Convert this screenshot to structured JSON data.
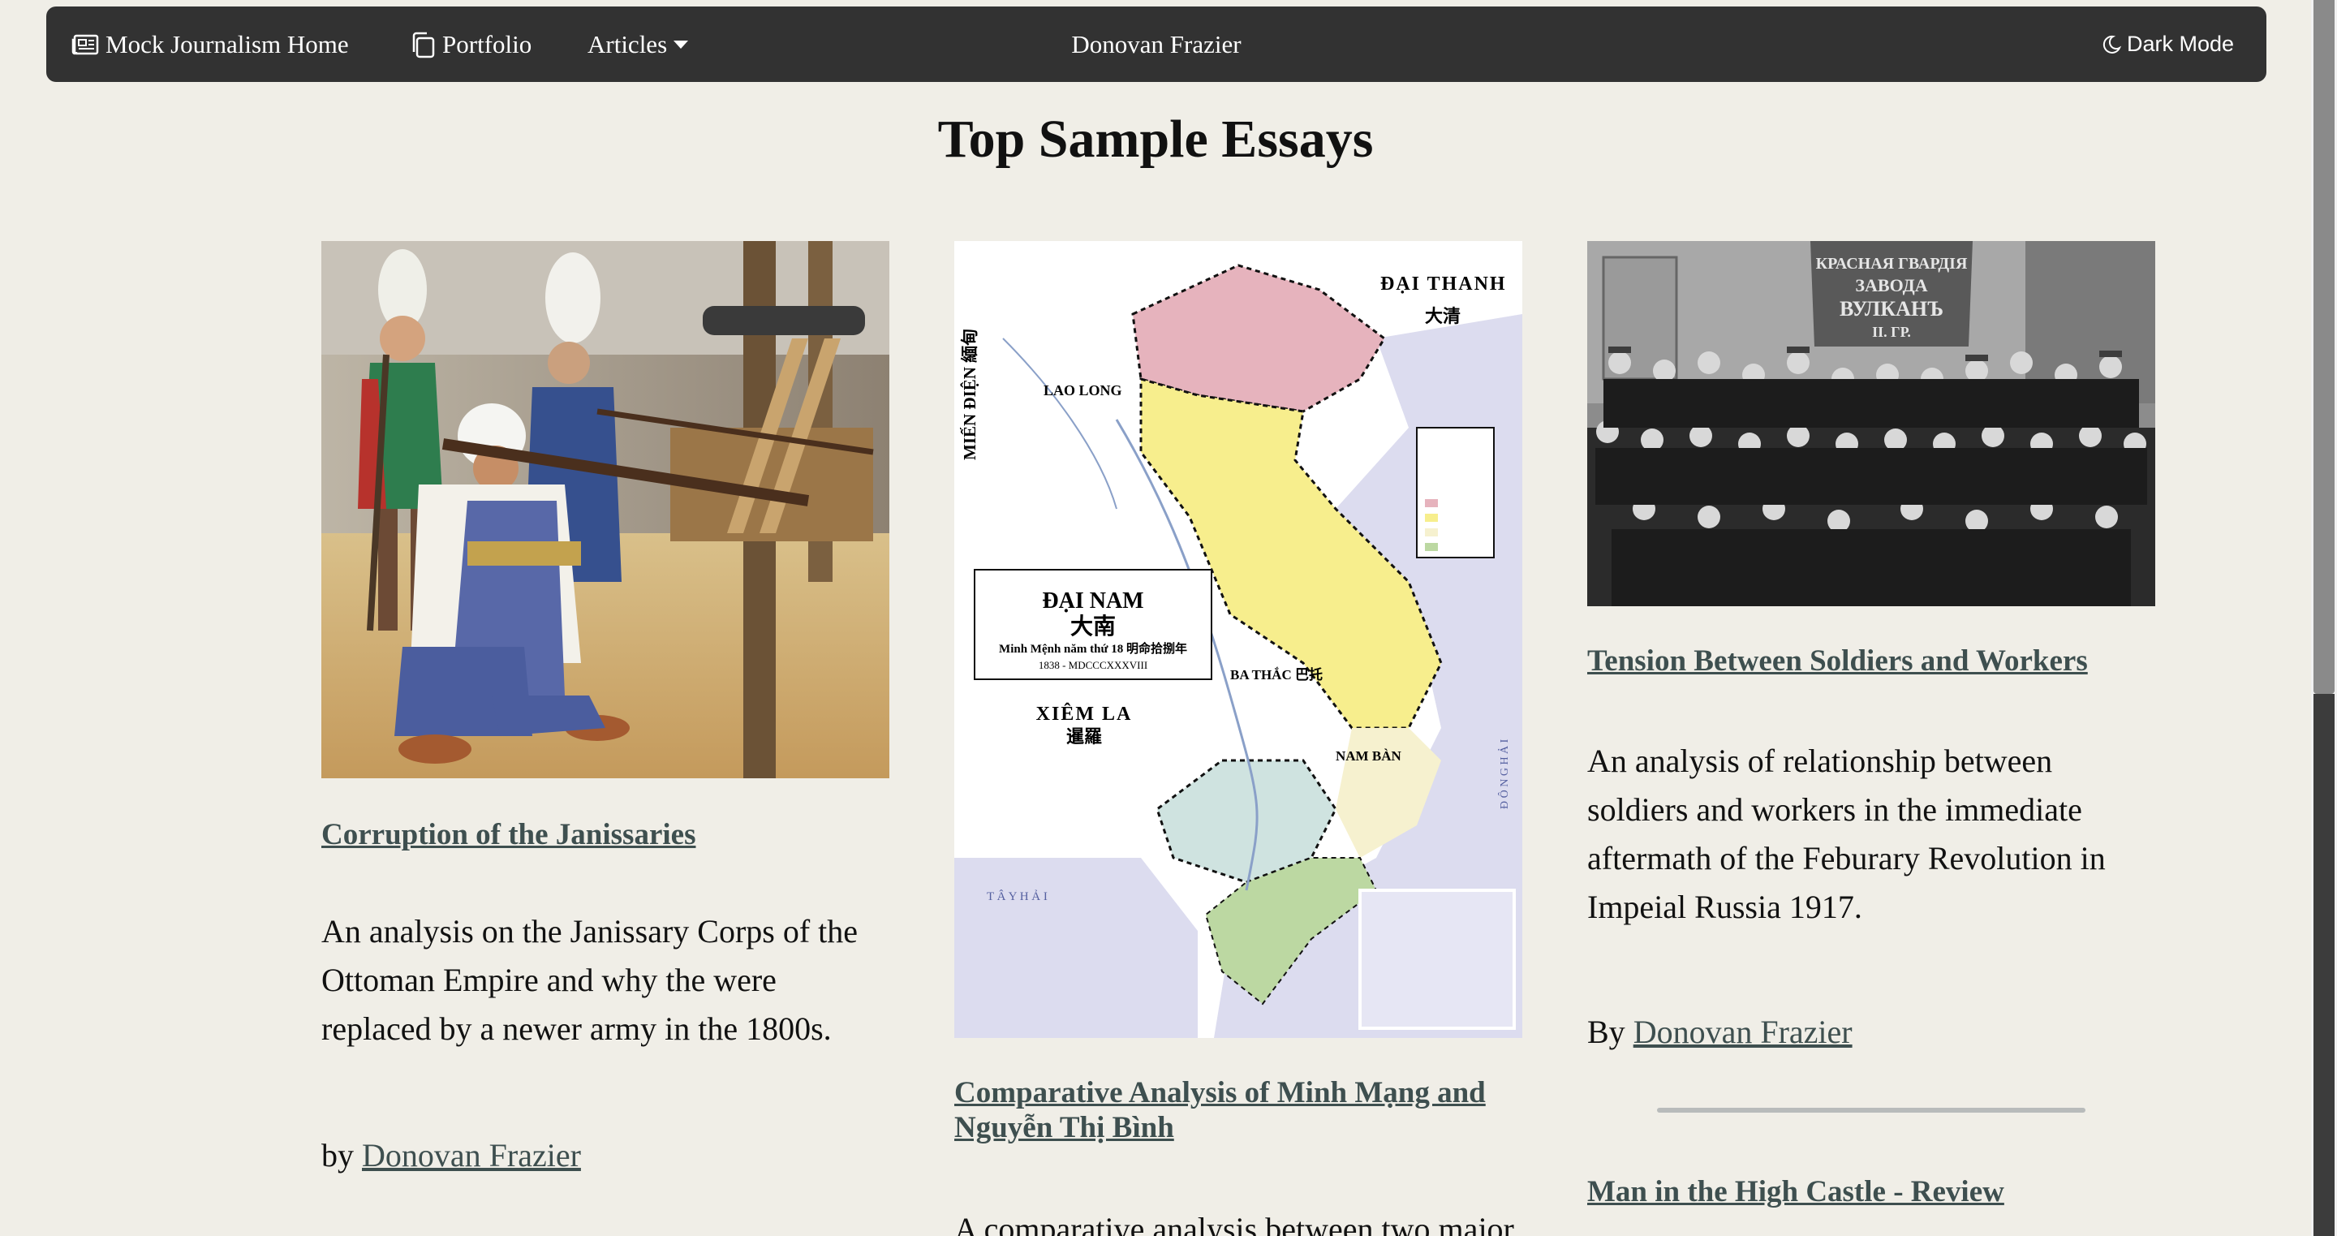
{
  "nav": {
    "home_label": "Mock Journalism Home",
    "portfolio_label": "Portfolio",
    "articles_label": "Articles",
    "brand": "Donovan Frazier",
    "dark_mode_label": "Dark Mode"
  },
  "page_title": "Top Sample Essays",
  "articles": [
    {
      "title": "Corruption of the Janissaries",
      "description": "An analysis on the Janissary Corps of the Ottoman Empire and why the were replaced by a newer army in the 1800s.",
      "by_prefix": "by",
      "author": "Donovan Frazier",
      "image": "janissaries-painting"
    },
    {
      "title": "Comparative Analysis of Minh Mạng and Nguyễn Thị Bình",
      "description": "A comparative analysis between two major",
      "image": "dai-nam-map",
      "map_labels": {
        "title": "ĐẠI NAM",
        "title_han": "大南",
        "subtitle": "Minh Mệnh năm thứ 18 明命拾捌年",
        "date": "1838 - MDCCCXXXVIII",
        "dai_thanh": "ĐẠI THANH",
        "dai_thanh_han": "大清",
        "mien_dien": "MIẾN ĐIỆN 緬甸",
        "lao_long": "LAO LONG",
        "xiem_la": "XIÊM LA",
        "xiem_la_han": "暹羅",
        "ba_thac": "BA THẮC 巴托",
        "nam_ban": "NAM BÀN",
        "tay_hai": "T Â Y   H Ả I",
        "dong_hai": "Đ Ô N G   H Ả I"
      }
    },
    {
      "title": "Tension Between Soldiers and Workers",
      "description": "An analysis of relationship between soldiers and workers in the immediate aftermath of the Feburary Revolution in Impeial Russia 1917.",
      "by_prefix": "By",
      "author": "Donovan Frazier",
      "image": "soldiers-workers-photo",
      "banner_text": [
        "КРАСНАЯ ГВАРДІЯ",
        "ЗАВОДА",
        "ВУЛКАНЪ",
        "II. ГР."
      ]
    },
    {
      "title": "Man in the High Castle - Review"
    }
  ],
  "colors": {
    "background": "#f0eee7",
    "navbar": "#323232",
    "link": "#3e4f4f"
  }
}
